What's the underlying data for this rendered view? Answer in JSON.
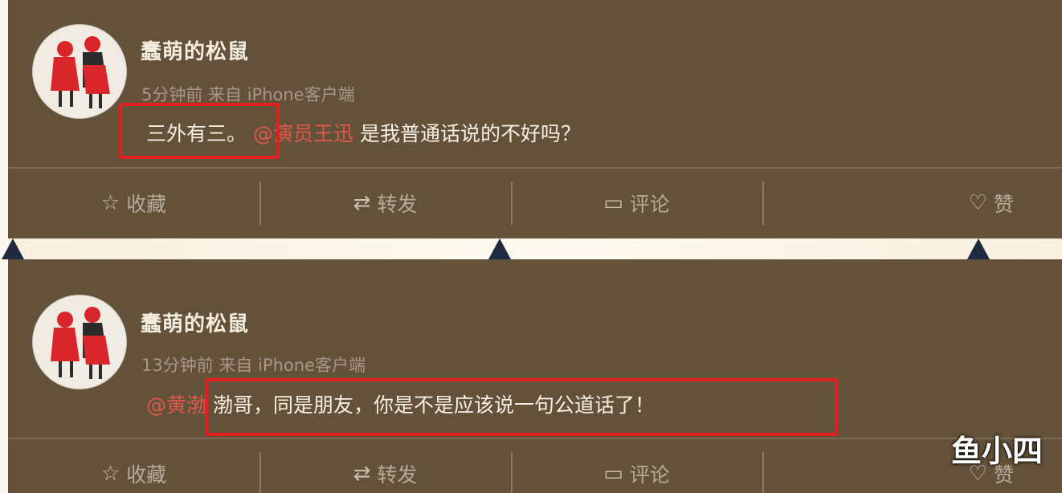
{
  "posts": [
    {
      "username": "蠢萌的松鼠",
      "meta": "5分钟前 来自 iPhone客户端",
      "content_prefix": "三外有三。",
      "mention": "@演员王迅",
      "content_suffix": " 是我普通话说的不好吗？",
      "actions": [
        {
          "icon": "star-icon",
          "label": "收藏"
        },
        {
          "icon": "repost-icon",
          "label": "转发"
        },
        {
          "icon": "comment-icon",
          "label": "评论"
        },
        {
          "icon": "like-icon",
          "label": "赞"
        }
      ]
    },
    {
      "username": "蠢萌的松鼠",
      "meta": "13分钟前 来自 iPhone客户端",
      "content_prefix": "",
      "mention": "@黄渤",
      "content_suffix": " 渤哥，同是朋友，你是不是应该说一句公道话了！",
      "actions": [
        {
          "icon": "star-icon",
          "label": "收藏"
        },
        {
          "icon": "repost-icon",
          "label": "转发"
        },
        {
          "icon": "comment-icon",
          "label": "评论"
        },
        {
          "icon": "like-icon",
          "label": "赞"
        }
      ]
    }
  ],
  "watermark": "鱼小四",
  "colors": {
    "card_bg": "#63513a",
    "mention": "#e0574b",
    "highlight_border": "#e0201e"
  }
}
